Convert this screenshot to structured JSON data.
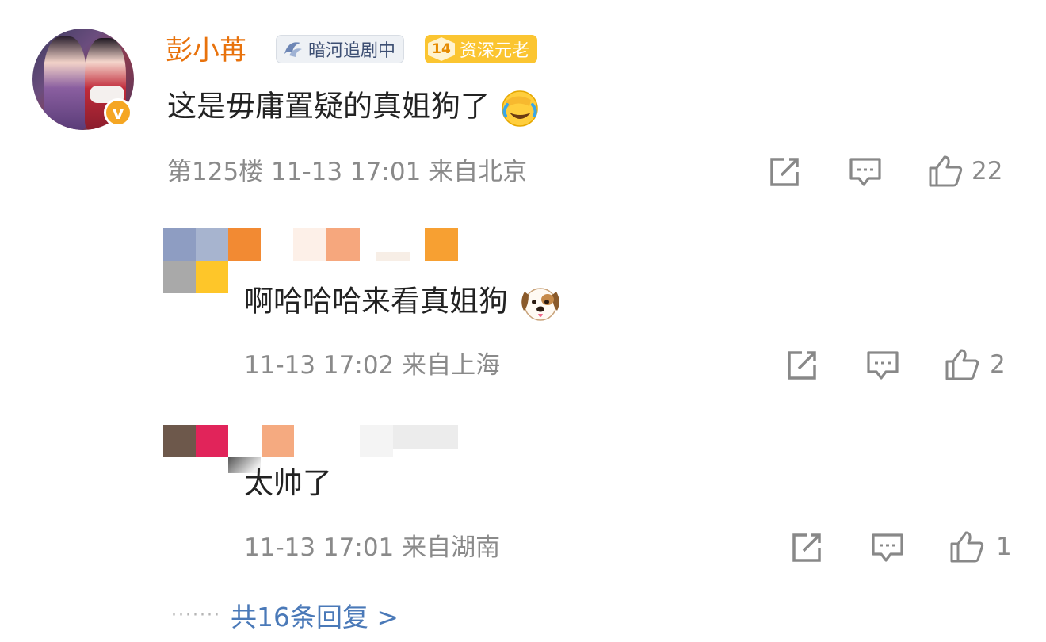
{
  "main_comment": {
    "username": "彭小苒",
    "fan_badge": "暗河追剧中",
    "level_badge": {
      "level": "14",
      "label": "资深元老"
    },
    "text": "这是毋庸置疑的真姐狗了",
    "emoji": "face-with-tears-of-joy-icon",
    "floor": "第125楼",
    "time": "11-13 17:01",
    "location": "来自北京",
    "likes": "22"
  },
  "replies": [
    {
      "text": "啊哈哈哈来看真姐狗",
      "emoji": "dog-face-icon",
      "time": "11-13 17:02",
      "location": "来自上海",
      "likes": "2"
    },
    {
      "text": "太帅了",
      "time": "11-13 17:01",
      "location": "来自湖南",
      "likes": "1"
    }
  ],
  "footer": {
    "more_replies": "共16条回复 >"
  },
  "colors": {
    "username": "#e8720c",
    "link": "#4a79b8",
    "meta": "#8a8a8a"
  }
}
